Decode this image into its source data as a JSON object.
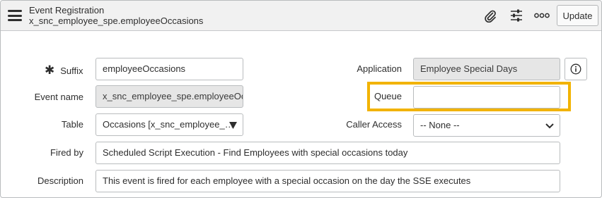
{
  "header": {
    "title": "Event Registration",
    "subtitle": "x_snc_employee_spe.employeeOccasions",
    "update_label": "Update",
    "icons": [
      "menu-icon",
      "paperclip-icon",
      "sliders-icon",
      "more-icon"
    ]
  },
  "form": {
    "suffix": {
      "label": "Suffix",
      "value": "employeeOccasions",
      "required_marker": "✱"
    },
    "event_name": {
      "label": "Event name",
      "value": "x_snc_employee_spe.employeeOccasions"
    },
    "table": {
      "label": "Table",
      "value": "Occasions [x_snc_employee_spe_occasions]",
      "display": "Occasions [x_snc_employee_…"
    },
    "fired_by": {
      "label": "Fired by",
      "value": "Scheduled Script Execution - Find Employees with special occasions today"
    },
    "description": {
      "label": "Description",
      "value": "This event is fired for each employee with a special occasion on the day the SSE executes"
    },
    "application": {
      "label": "Application",
      "value": "Employee Special Days"
    },
    "queue": {
      "label": "Queue",
      "value": ""
    },
    "caller_access": {
      "label": "Caller Access",
      "value": "-- None --",
      "options": [
        "-- None --"
      ]
    }
  },
  "colors": {
    "highlight": "#f2b300",
    "header_bg": "#f1f1f1",
    "readonly_bg": "#e6e6e6"
  }
}
